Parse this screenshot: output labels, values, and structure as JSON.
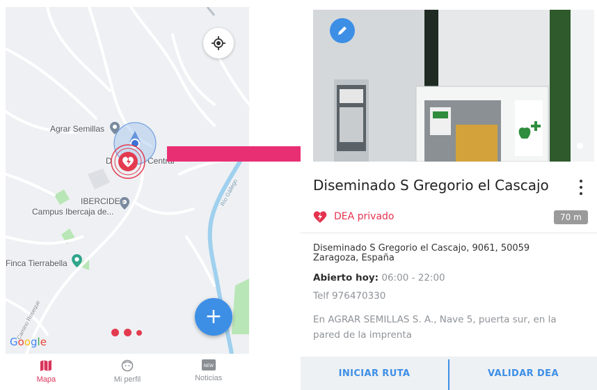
{
  "map": {
    "labels": {
      "agrar": "Agrar Semillas",
      "central": "D",
      "central_tail": "Central",
      "ibercide_1": "IBERCIDE -",
      "ibercide_2": "Campus Ibercaja de...",
      "finca": "Finca Tierrabella",
      "road_right": "Río Gállego",
      "road_left": "Camino Roseque"
    },
    "google_logo": "Google",
    "fab_icon": "plus-icon",
    "locate_icon": "my-location-icon",
    "colors": {
      "marker": "#e33a4f",
      "accent": "#3d8fe6",
      "water": "#9fd0ee",
      "park": "#b9e6b6"
    }
  },
  "bottom_nav": {
    "items": [
      {
        "label": "Mapa",
        "icon": "map-icon",
        "active": true
      },
      {
        "label": "Mi perfil",
        "icon": "face-icon",
        "active": false
      },
      {
        "label": "Noticias",
        "icon": "new-badge-icon",
        "active": false
      }
    ]
  },
  "detail": {
    "title": "Diseminado S Gregorio el Cascajo",
    "type_label": "DEA privado",
    "distance": "70 m",
    "address": "Diseminado S Gregorio el Cascajo, 9061, 50059 Zaragoza, España",
    "hours_label": "Abierto hoy:",
    "hours_value": "06:00 - 22:00",
    "phone": "Telf 976470330",
    "description": "En AGRAR SEMILLAS S. A., Nave 5, puerta sur, en la pared de la imprenta",
    "actions": {
      "start_route": "INICIAR RUTA",
      "validate": "VALIDAR DEA"
    }
  }
}
